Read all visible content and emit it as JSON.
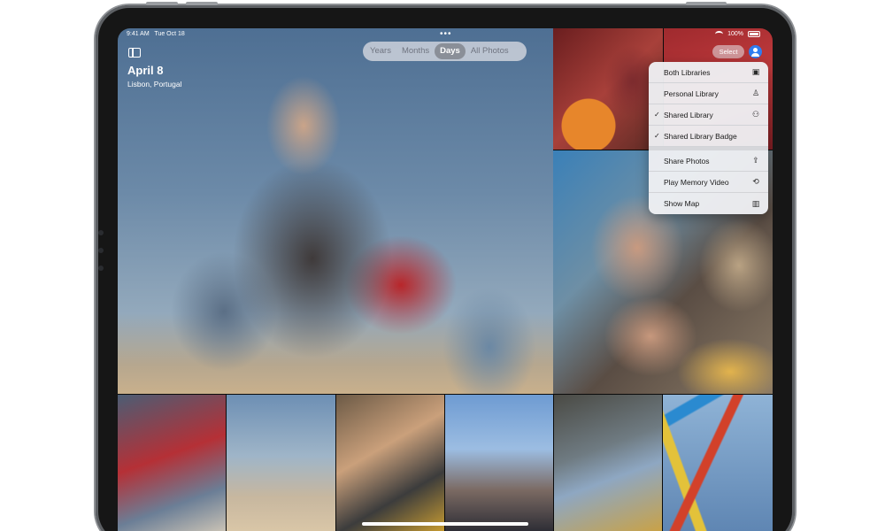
{
  "status_bar": {
    "time": "9:41 AM",
    "date": "Tue Oct 18",
    "battery": "100%"
  },
  "header": {
    "title": "April 8",
    "subtitle": "Lisbon, Portugal",
    "more_dots": "•••"
  },
  "view_picker": {
    "options": [
      "Years",
      "Months",
      "Days",
      "All Photos"
    ],
    "selected": "Days"
  },
  "toolbar": {
    "select_label": "Select"
  },
  "menu": {
    "items": [
      {
        "label": "Both Libraries",
        "icon": "photo-stack-icon",
        "glyph": "▣",
        "checked": false
      },
      {
        "label": "Personal Library",
        "icon": "person-icon",
        "glyph": "♙",
        "checked": false
      },
      {
        "label": "Shared Library",
        "icon": "people-icon",
        "glyph": "⚇",
        "checked": true
      },
      {
        "label": "Shared Library Badge",
        "icon": "",
        "glyph": "",
        "checked": true
      },
      {
        "label": "Share Photos",
        "icon": "share-icon",
        "glyph": "⇪",
        "checked": false
      },
      {
        "label": "Play Memory Video",
        "icon": "memory-play-icon",
        "glyph": "⟲",
        "checked": false
      },
      {
        "label": "Show Map",
        "icon": "map-icon",
        "glyph": "▥",
        "checked": false
      }
    ],
    "check_glyph": "✓"
  },
  "colors": {
    "accent": "#2f7df0",
    "menu_bg": "#eeeff2"
  }
}
